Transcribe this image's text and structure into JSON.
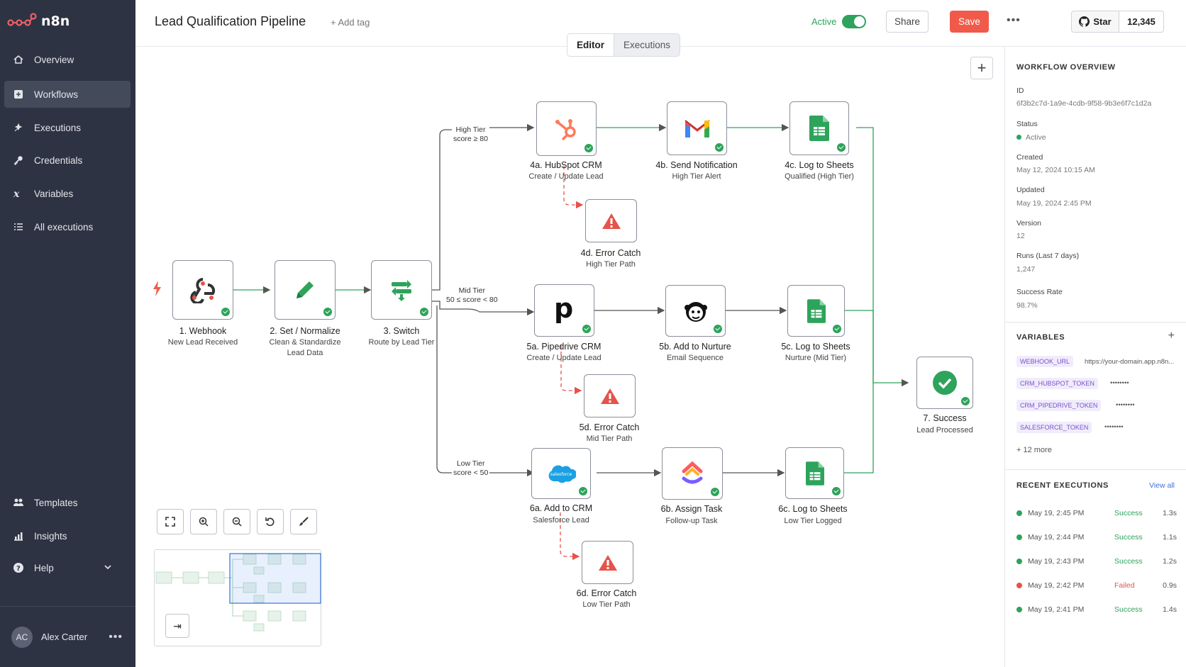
{
  "app": {
    "brand": "n8n"
  },
  "sidebar": {
    "items": [
      {
        "label": "Overview",
        "icon": "home-icon"
      },
      {
        "label": "Workflows",
        "icon": "workflow-icon",
        "active": true
      },
      {
        "label": "Executions",
        "icon": "executions-icon"
      },
      {
        "label": "Credentials",
        "icon": "key-icon"
      },
      {
        "label": "Variables",
        "icon": "variable-icon"
      },
      {
        "label": "All executions",
        "icon": "list-icon"
      }
    ],
    "bottom_items": [
      {
        "label": "Templates",
        "icon": "templates-icon"
      },
      {
        "label": "Insights",
        "icon": "insights-icon"
      },
      {
        "label": "Help",
        "icon": "help-icon"
      }
    ],
    "user": {
      "initials": "AC",
      "name": "Alex Carter"
    }
  },
  "header": {
    "title": "Lead Qualification Pipeline",
    "add_tag": "+ Add tag",
    "active_label": "Active",
    "share": "Share",
    "save": "Save",
    "star": "Star",
    "star_count": "12,345"
  },
  "tabs": [
    {
      "label": "Editor",
      "selected": true
    },
    {
      "label": "Executions"
    }
  ],
  "nodes": {
    "webhook": {
      "title": "1. Webhook",
      "sub": "New Lead Received"
    },
    "set": {
      "title": "2. Set / Normalize",
      "sub1": "Clean & Standardize",
      "sub2": "Lead Data"
    },
    "switch": {
      "title": "3. Switch",
      "sub": "Route by Lead Tier"
    },
    "hubspot": {
      "title": "4a. HubSpot CRM",
      "sub": "Create / Update Lead"
    },
    "gmail": {
      "title": "4b. Send Notification",
      "sub": "High Tier Alert"
    },
    "sheets_high": {
      "title": "4c. Log to Sheets",
      "sub": "Qualified (High Tier)"
    },
    "err_high": {
      "title": "4d. Error Catch",
      "sub": "High Tier Path"
    },
    "pipedrive": {
      "title": "5a. Pipedrive CRM",
      "sub": "Create / Update Lead"
    },
    "mailchimp": {
      "title": "5b. Add to Nurture",
      "sub": "Email Sequence"
    },
    "sheets_mid": {
      "title": "5c. Log to Sheets",
      "sub": "Nurture (Mid Tier)"
    },
    "err_mid": {
      "title": "5d. Error Catch",
      "sub": "Mid Tier Path"
    },
    "salesforce": {
      "title": "6a. Add to CRM",
      "sub": "Salesforce Lead",
      "logo_text": "salesforce"
    },
    "clickup": {
      "title": "6b. Assign Task",
      "sub": "Follow-up Task"
    },
    "sheets_low": {
      "title": "6c. Log to Sheets",
      "sub": "Low Tier Logged"
    },
    "err_low": {
      "title": "6d. Error Catch",
      "sub": "Low Tier Path"
    },
    "success": {
      "title": "7. Success",
      "sub": "Lead Processed"
    }
  },
  "branches": {
    "high": {
      "line1": "High Tier",
      "line2": "score ≥ 80"
    },
    "mid": {
      "line1": "Mid Tier",
      "line2": "50 ≤ score < 80"
    },
    "low": {
      "line1": "Low Tier",
      "line2": "score < 50"
    }
  },
  "panel": {
    "overview_title": "WORKFLOW OVERVIEW",
    "fields": [
      {
        "key": "ID",
        "value": "6f3b2c7d-1a9e-4cdb-9f58-9b3e6f7c1d2a"
      },
      {
        "key": "Status",
        "value": "Active"
      },
      {
        "key": "Created",
        "value": "May 12, 2024 10:15 AM"
      },
      {
        "key": "Updated",
        "value": "May 19, 2024 2:45 PM"
      },
      {
        "key": "Version",
        "value": "12"
      },
      {
        "key": "Runs (Last 7 days)",
        "value": "1,247"
      },
      {
        "key": "Success Rate",
        "value": "98.7%"
      }
    ],
    "variables_title": "VARIABLES",
    "variables": [
      {
        "name": "WEBHOOK_URL",
        "value": "https://your-domain.app.n8n..."
      },
      {
        "name": "CRM_HUBSPOT_TOKEN",
        "value": "••••••••"
      },
      {
        "name": "CRM_PIPEDRIVE_TOKEN",
        "value": "••••••••"
      },
      {
        "name": "SALESFORCE_TOKEN",
        "value": "••••••••"
      }
    ],
    "more_vars": "+ 12 more",
    "recent_title": "RECENT EXECUTIONS",
    "view_all": "View all",
    "executions": [
      {
        "time": "May 19, 2:45 PM",
        "status": "Success",
        "duration": "1.3s"
      },
      {
        "time": "May 19, 2:44 PM",
        "status": "Success",
        "duration": "1.1s"
      },
      {
        "time": "May 19, 2:43 PM",
        "status": "Success",
        "duration": "1.2s"
      },
      {
        "time": "May 19, 2:42 PM",
        "status": "Failed",
        "duration": "0.9s"
      },
      {
        "time": "May 19, 2:41 PM",
        "status": "Success",
        "duration": "1.4s"
      }
    ]
  },
  "colors": {
    "success": "#2ea35b",
    "failed": "#e5534b",
    "accent": "#f15a4a",
    "sidebar": "#2e3343"
  }
}
